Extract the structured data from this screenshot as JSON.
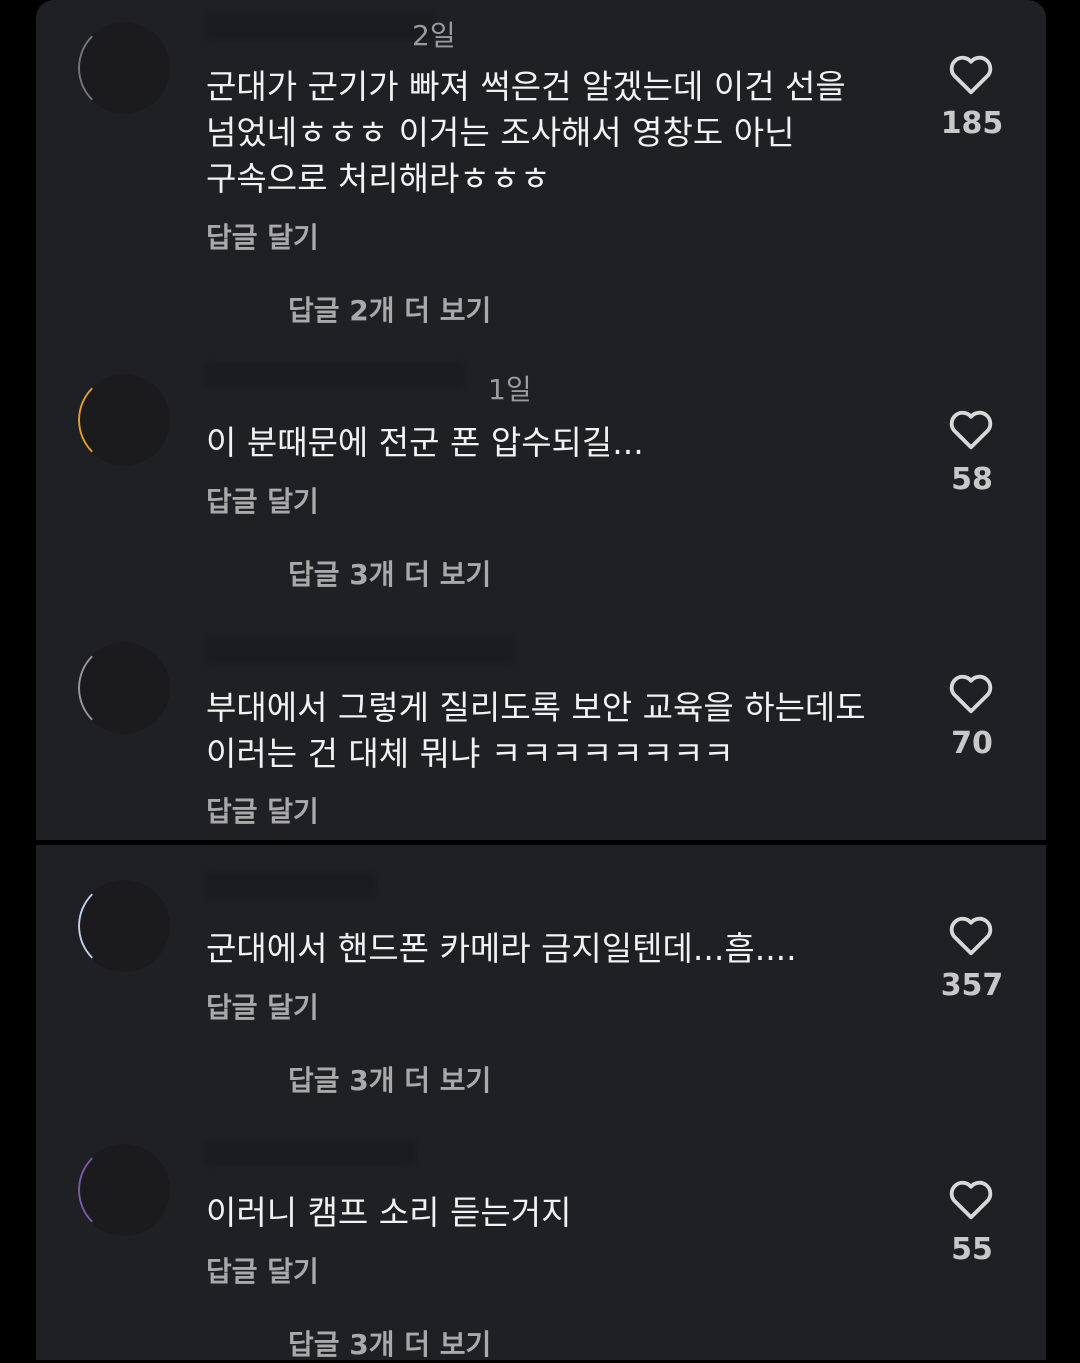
{
  "comments": [
    {
      "time": "2일",
      "text": "군대가 군기가 빠져 썩은건 알겠는데 이건 선을\n넘었네ㅎㅎㅎ 이거는 조사해서 영창도 아닌\n구속으로 처리해라ㅎㅎㅎ",
      "reply_label": "답글 달기",
      "more_replies": "답글 2개 더 보기",
      "likes": "185"
    },
    {
      "time": "1일",
      "text": "이 분때문에 전군 폰 압수되길...",
      "reply_label": "답글 달기",
      "more_replies": "답글 3개 더 보기",
      "likes": "58"
    },
    {
      "time": "",
      "text": "부대에서 그렇게 질리도록 보안 교육을 하는데도\n이러는 건 대체 뭐냐 ㅋㅋㅋㅋㅋㅋㅋㅋ",
      "reply_label": "답글 달기",
      "more_replies": "",
      "likes": "70"
    },
    {
      "time": "",
      "text": "군대에서 핸드폰 카메라 금지일텐데...흠....",
      "reply_label": "답글 달기",
      "more_replies": "답글 3개 더 보기",
      "likes": "357"
    },
    {
      "time": "",
      "text": "이러니 캠프 소리 듣는거지",
      "reply_label": "답글 달기",
      "more_replies": "답글 3개 더 보기",
      "likes": "55"
    }
  ],
  "icons": {
    "like": "heart-outline-icon"
  },
  "colors": {
    "background": "#000000",
    "panel": "#1f2024",
    "text": "#f2f2f2",
    "muted": "#a9a9a9"
  }
}
